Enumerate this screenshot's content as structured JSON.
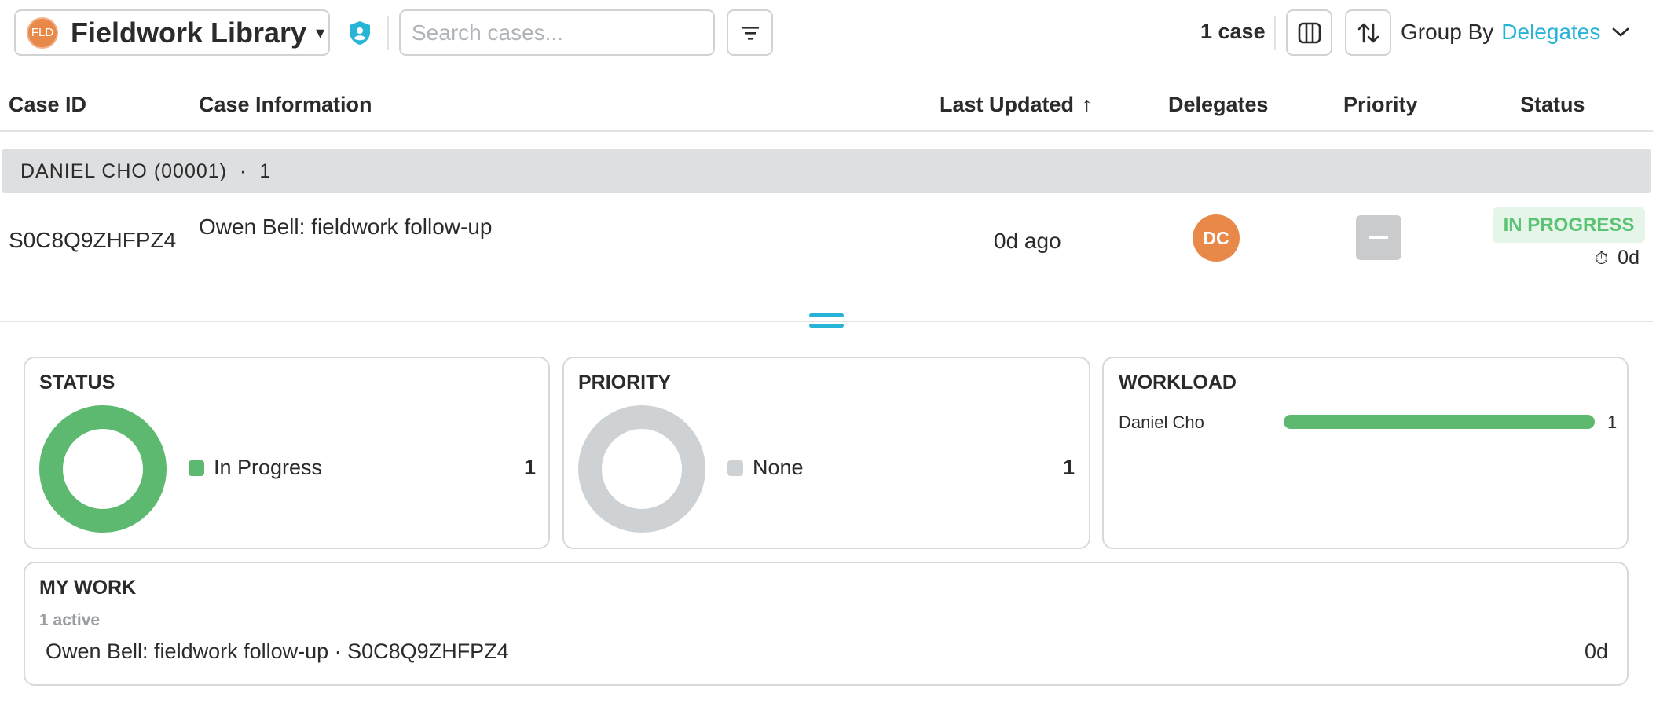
{
  "toolbar": {
    "logo_text": "FLD",
    "library_title": "Fieldwork Library",
    "caret": "▾",
    "search_placeholder": "Search cases...",
    "case_count": "1 case",
    "group_by_label": "Group By",
    "group_by_value": "Delegates",
    "icons": [
      "shield-user-icon",
      "filter-icon",
      "columns-icon",
      "sort-icon",
      "chevron-down-icon"
    ]
  },
  "table": {
    "headers": {
      "case_id": "Case ID",
      "case_info": "Case Information",
      "last_updated": "Last Updated",
      "sort_arrow": "↑",
      "delegates": "Delegates",
      "priority": "Priority",
      "status": "Status"
    },
    "group": {
      "name": "DANIEL CHO (00001)",
      "separator": "·",
      "count": "1"
    },
    "rows": [
      {
        "case_id": "S0C8Q9ZHFPZ4",
        "case_info": "Owen Bell: fieldwork follow-up",
        "last_updated": "0d ago",
        "delegate_initials": "DC",
        "priority": "none",
        "status": "IN PROGRESS",
        "timer_icon": "⏱",
        "timer": "0d"
      }
    ]
  },
  "cards": {
    "status": {
      "title": "STATUS",
      "legend": [
        {
          "label": "In Progress",
          "count": "1",
          "color": "#5cb96f"
        }
      ]
    },
    "priority": {
      "title": "PRIORITY",
      "legend": [
        {
          "label": "None",
          "count": "1",
          "color": "#cfd2d4"
        }
      ]
    },
    "workload": {
      "title": "WORKLOAD",
      "rows": [
        {
          "name": "Daniel Cho",
          "count": "1",
          "fraction": 1.0
        }
      ]
    },
    "my_work": {
      "title": "MY WORK",
      "subtitle": "1 active",
      "items": [
        {
          "text": "Owen Bell: fieldwork follow-up · S0C8Q9ZHFPZ4",
          "age": "0d"
        }
      ]
    }
  },
  "colors": {
    "accent": "#27b4d6",
    "avatar": "#e8894a",
    "in_progress": "#5cb96f",
    "none": "#cfd2d4"
  }
}
